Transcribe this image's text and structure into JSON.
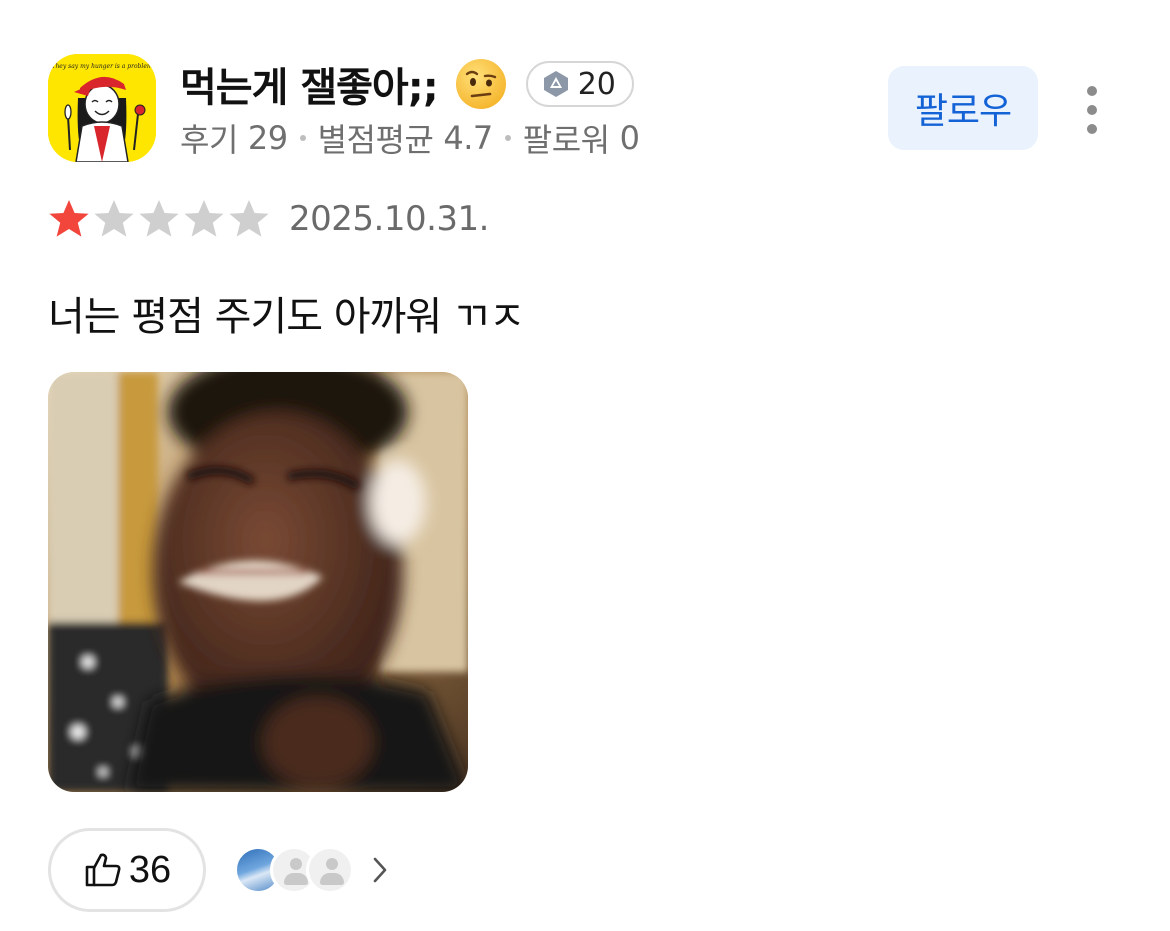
{
  "reviewer": {
    "name": "먹는게 잴좋아;;",
    "avatar_tagline": "They say my hunger is a problem",
    "emoji_icon": "face-with-raised-eyebrow-icon",
    "level": "20",
    "stats": {
      "reviews_label": "후기",
      "reviews_value": "29",
      "avg_label": "별점평균",
      "avg_value": "4.7",
      "followers_label": "팔로워",
      "followers_value": "0"
    }
  },
  "actions": {
    "follow_label": "팔로우",
    "more_icon": "more-vertical-icon"
  },
  "review": {
    "rating": 1,
    "rating_max": 5,
    "star_filled_color": "#f2463d",
    "star_empty_color": "#cfcfcf",
    "date": "2025.10.31.",
    "text": "너는 평점 주기도 아까워 ㄲㅈ"
  },
  "reactions": {
    "like_icon": "thumbs-up-icon",
    "like_count": "36",
    "chevron_icon": "chevron-right-icon"
  },
  "colors": {
    "accent": "#1463d6",
    "follow_bg": "#eaf2fe"
  }
}
